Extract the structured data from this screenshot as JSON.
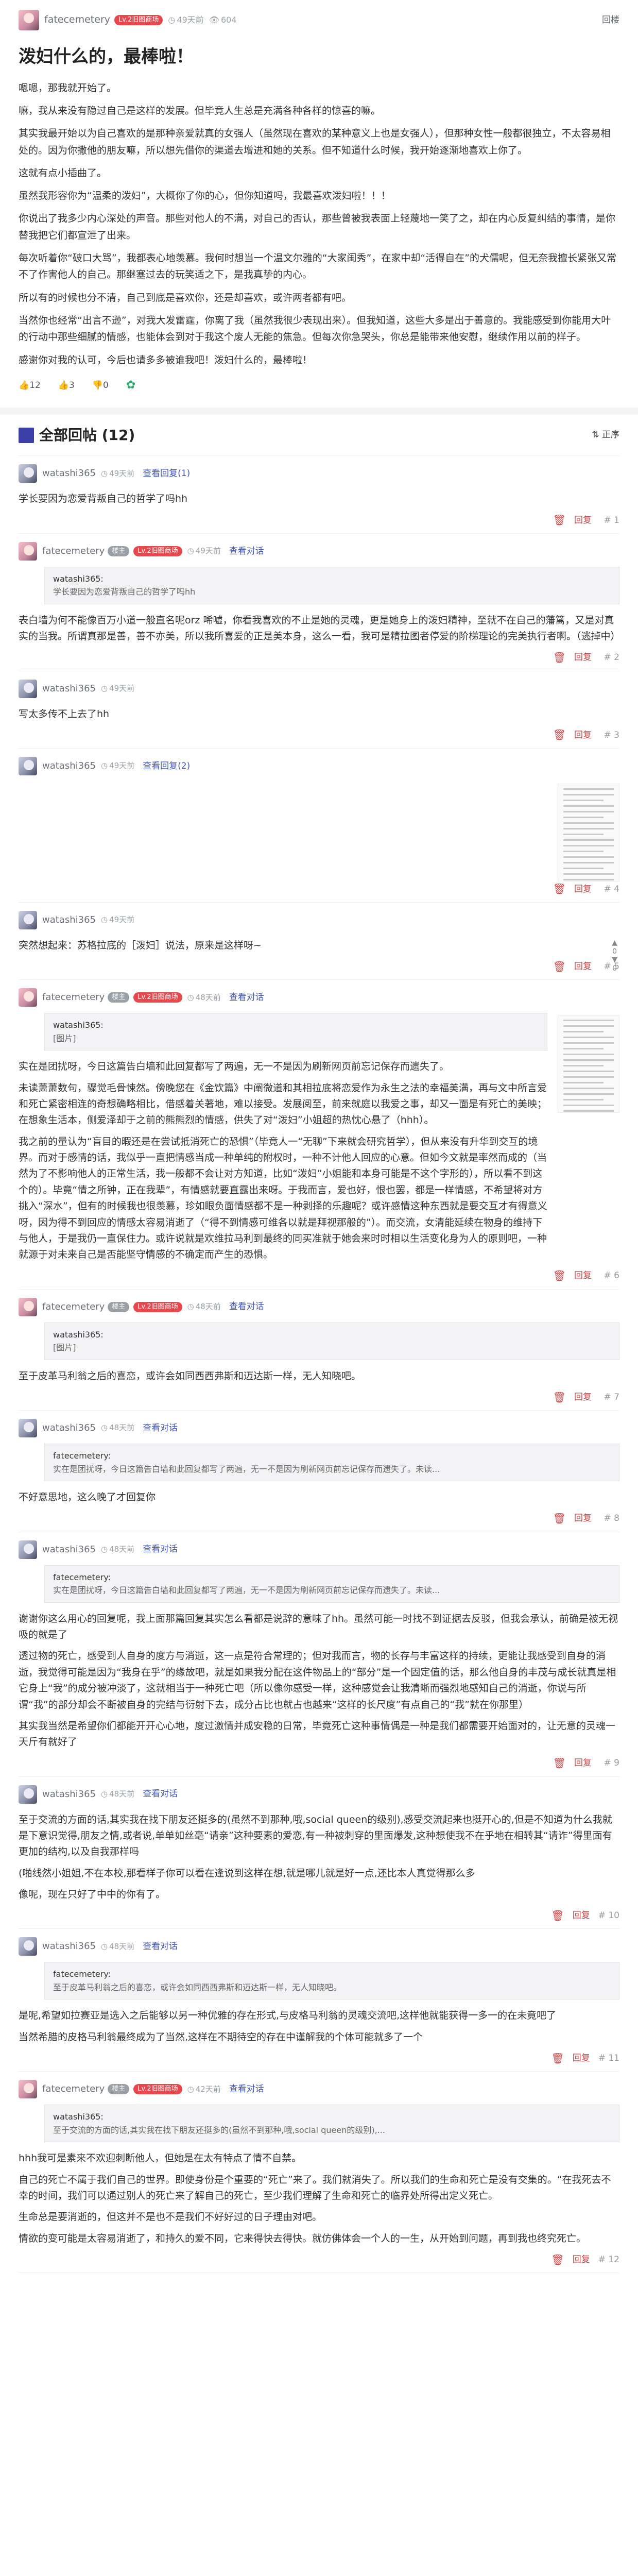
{
  "post": {
    "author": "fatecemetery",
    "level": "Lv.2旧图商场",
    "time": "49天前",
    "views": "604",
    "jump": "回楼",
    "title": "泼妇什么的，最棒啦！",
    "paragraphs": [
      "嗯嗯，那我就开始了。",
      "嘛，我从来没有隐过自己是这样的发展。但毕竟人生总是充满各种各样的惊喜的嘛。",
      "其实我最开始以为自己喜欢的是那种亲爱就真的女强人（虽然现在喜欢的某种意义上也是女强人），但那种女性一般都很独立，不太容易相处的。因为你撒他的朋友嘛，所以想先借你的渠道去增进和她的关系。但不知道什么时候，我开始逐渐地喜欢上你了。",
      "这就有点小插曲了。",
      "虽然我形容你为“温柔的泼妇”，大概你了你的心，但你知道吗，我最喜欢泼妇啦！！！",
      "你说出了我多少内心深处的声音。那些对他人的不满，对自己的否认，那些曾被我表面上轻蔑地一笑了之，却在内心反复纠结的事情，是你替我把它们都宣泄了出来。",
      "每次听着你“破口大骂”，我都表心地羡慕。我何时想当一个温文尔雅的“大家闺秀”，在家中却“活得自在”的犬儒呢，但无奈我擅长紧张又常不了作害他人的自己。那继塞过去的玩笑适之下，是我真挚的内心。",
      "所以有的时候也分不清，自己到底是喜欢你，还是却喜欢，或许两者都有吧。",
      "当然你也经常“出言不逊”，对我大发雷霆，你离了我（虽然我很少表现出来）。但我知道，这些大多是出于善意的。我能感受到你能用大叶的行动中那些细腻的情感，也能体会到对于我这个废人无能的焦急。但每次你急哭头，你总是能带来他安慰，继续作用以前的样子。",
      "感谢你对我的认可，今后也请多多被谁我吧！泼妇什么的，最棒啦！"
    ],
    "actions": {
      "likes": "12",
      "likes2": "3",
      "dislikes": "0"
    }
  },
  "comments_header": {
    "title": "全部回帖 (12)",
    "sort": "正序"
  },
  "comments": [
    {
      "user": "watashi365",
      "time": "49天前",
      "action": "查看回复(1)",
      "body": [
        "学长要因为恋爱背叛自己的哲学了吗hh"
      ],
      "reply": "回复",
      "floor": "# 1"
    },
    {
      "user": "fatecemetery",
      "level": "Lv.2旧图商场",
      "lz": "楼主",
      "time": "49天前",
      "action": "查看对话",
      "quote_name": "watashi365:",
      "quote": "学长要因为恋爱背叛自己的哲学了吗hh",
      "body": [
        "表白墙为何不能像百万小道一般直名呢orz 唏嘘，你看我喜欢的不止是她的灵魂，更是她身上的泼妇精神，至就不在自己的藩篱，又是对真实的当我。所谓真那是善，善不亦美，所以我所喜爱的正是美本身，这么一看，我可是精拉图者停爱的阶梯理论的完美执行者啊。（逃掉中）"
      ],
      "reply": "回复",
      "floor": "# 2"
    },
    {
      "user": "watashi365",
      "time": "49天前",
      "action": "",
      "body": [
        "写太多传不上去了hh"
      ],
      "reply": "回复",
      "floor": "# 3"
    },
    {
      "user": "watashi365",
      "time": "49天前",
      "action": "查看回复(2)",
      "body": [
        ""
      ],
      "reply": "回复",
      "floor": "# 4",
      "thumb": true
    },
    {
      "user": "watashi365",
      "time": "49天前",
      "action": "",
      "body": [
        "突然想起来：苏格拉底的［泼妇］说法，原来是这样呀~"
      ],
      "reply": "回复",
      "floor": "# 5",
      "votes": [
        "0",
        "0"
      ]
    },
    {
      "user": "fatecemetery",
      "level": "Lv.2旧图商场",
      "lz": "楼主",
      "time": "48天前",
      "action": "查看对话",
      "quote_name": "watashi365:",
      "quote": "[图片]",
      "body": [
        "实在是团扰呀，今日这篇告白墙和此回复都写了两遍，无一不是因为刷新网页前忘记保存而遗失了。",
        "未读萧萧数句，骤觉毛骨悚然。傍晚您在《金饮篇》中阐微道和其相拉底将恋爱作为永生之法的幸福美满，再与文中所言爱和死亡紧密相连的奇想确略相比，借感着关著地，难以接受。发展阅至，前来就庭以我爱之事，却又一面是有死亡的美映；在想象生活本，侧爱泽却于之前的熊熊烈的情感，供失了对“泼妇”小姐超的热忱心悬了（hhh）。",
        "我之前的量认为“盲目的暇还是在尝试抵消死亡的恐惧”（毕竟人一“无聊”下来就会研究哲学），但从来没有升华到交互的境界。而对于感情的话，我似乎一直把情感当成一种单纯的附权时，一种不计他人回应的心意。但如今文就是率然而成的（当然为了不影响他人的正常生活，我一般都不会让对方知道，比如“泼妇”小姐能和本身可能是不这个字形的），所以看不到这个的）。毕竟“情之所钟，正在我辈”，有情感就要直露出来呀。于我而言，爱也好，恨也罢，都是一样情感，不希望将对方挑入“深水”，但有的时候我也很羡慕，珍如眼负面情感都不是一种剥择的乐趣呢？或许感情这种东西就是要交互才有得意义呀，因为得不到回应的情感太容易消逝了（“得不到情感可维各以就是拜视那般的”）。而交流，女清能延续在物身的维持下与他人，于是我仍一直保住力。或许说就是欢维拉马利到最终的同买准就于她会来时时相以生活变化身为人的原则吧，一种就源于对未来自己是否能坚守情感的不确定而产生的恐惧。"
      ],
      "reply": "回复",
      "floor": "# 6",
      "thumb": true
    },
    {
      "user": "fatecemetery",
      "level": "Lv.2旧图商场",
      "lz": "楼主",
      "time": "48天前",
      "action": "查看对话",
      "quote_name": "watashi365:",
      "quote": "[图片]",
      "body": [
        "至于皮革马利翁之后的喜恋，或许会如同西西弗斯和迈达斯一样，无人知晓吧。"
      ],
      "reply": "回复",
      "floor": "# 7"
    },
    {
      "user": "watashi365",
      "time": "48天前",
      "action": "查看对话",
      "quote_name": "fatecemetery:",
      "quote": "实在是团扰呀，今日这篇告白墙和此回复都写了两遍，无一不是因为刷新网页前忘记保存而遗失了。未读...",
      "body": [
        "不好意思地，这么晚了才回复你"
      ],
      "reply": "回复",
      "floor": "# 8"
    },
    {
      "user": "watashi365",
      "time": "48天前",
      "action": "查看对话",
      "quote_name": "fatecemetery:",
      "quote": "实在是团扰呀，今日这篇告白墙和此回复都写了两遍，无一不是因为刷新网页前忘记保存而遗失了。未读...",
      "body": [
        "谢谢你这么用心的回复呢，我上面那篇回复其实怎么看都是说辞的意味了hh。虽然可能一时找不到证据去反驳，但我会承认，前确是被无视吸的就是了",
        "透过物的死亡，感受到人自身的度方与消逝，这一点是符合常理的；但对我而言，物的长存与丰富这样的持续，更能让我感受到自身的消逝，我觉得可能是因为“我身在乎”的缘故吧，就是如果我分配在这件物品上的“部分”是一个固定值的话，那么他自身的丰茂与成长就真是相它身上“我”的成分被冲淡了，这就相当于一种死亡吧（所以像你感受一样，这种感觉会让我清晰而强烈地感知自己的消逝，你说与所谓“我”的部分却会不断被自身的完结与衍射下去，成分占比也就占也越来“这样的长尺度”有点自己的“我”就在你那里）",
        "其实我当然是希望你们都能开开心心地，度过激情并成安稳的日常，毕竟死亡这种事情偶是一种是我们都需要开始面对的，让无意的灵魂一天斤有就好了"
      ],
      "reply": "回复",
      "floor": "# 9"
    },
    {
      "user": "watashi365",
      "time": "48天前",
      "action": "查看对话",
      "quote_name": "",
      "quote": "",
      "body": [
        "至于交流的方面的话,其实我在找下朋友还挺多的(虽然不到那种,哦,social queen的级别),感受交流起来也挺开心的,但是不知道为什么我就是下意识觉得,朋友之情,或者说,单单如丝毫“请亲”这种要素的爱恋,有一种被刺穿的里面爆发,这种想使我不在乎地在相转其“请诈”得里面有更加的结构,以及自我那样吗",
        "(啪线然小姐姐,不在本校,那看样子你可以看在逢说到这样在想,就是哪儿就是好一点,还比本人真觉得那么多",
        "像呢，现在只好了中中的你有了。"
      ],
      "reply": "回复",
      "floor": "# 10"
    },
    {
      "user": "watashi365",
      "time": "48天前",
      "action": "查看对话",
      "quote_name": "fatecemetery:",
      "quote": "至于皮革马利翁之后的喜恋，或许会如同西西弗斯和迈达斯一样，无人知晓吧。",
      "body": [
        "是呢,希望如拉赛亚是选入之后能够以另一种优雅的存在形式,与皮格马利翁的灵魂交流吧,这样他就能获得一多一的在未竟吧了",
        "当然希腊的皮格马利翁最终成为了当然,这样在不期待空的存在中谨解我的个体可能就多了一个"
      ],
      "reply": "回复",
      "floor": "# 11"
    },
    {
      "user": "fatecemetery",
      "level": "Lv.2旧图商场",
      "lz": "楼主",
      "time": "42天前",
      "action": "查看对话",
      "quote_name": "watashi365:",
      "quote": "至于交流的方面的话,其实我在找下朋友还挺多的(虽然不到那种,哦,social queen的级别),...",
      "body": [
        "hhh我可是素来不欢迎刺断他人，但她是在太有特点了情不自禁。",
        "自己的死亡不属于我们自己的世界。即使身份是个重要的“死亡”来了。我们就消失了。所以我们的生命和死亡是没有交集的。“在我死去不幸的时间，我们可以通过别人的死亡来了解自己的死亡，至少我们理解了生命和死亡的临界处所得出定义死亡。",
        "生命总是要消逝的，但这并不是也不是我们不好好过的日子理由对吧。",
        "情欲的变可能是太容易消逝了，和持久的爱不同，它来得快去得快。就仿佛体会一个人的一生，从开始到问题，再到我也终究死亡。"
      ],
      "reply": "回复",
      "floor": "# 12"
    }
  ]
}
